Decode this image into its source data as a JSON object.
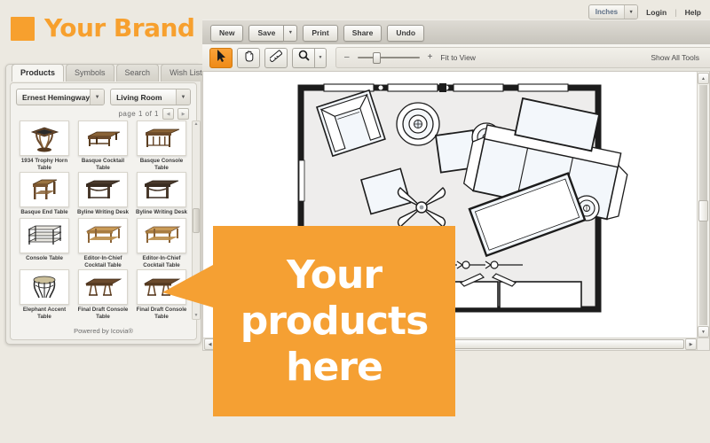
{
  "brand": {
    "name": "Your Brand",
    "mark_icon": "square-logo-mark",
    "accent_color": "#f7a02e"
  },
  "panel": {
    "tabs": [
      {
        "label": "Products",
        "active": true
      },
      {
        "label": "Symbols",
        "active": false
      },
      {
        "label": "Search",
        "active": false
      },
      {
        "label": "Wish List",
        "active": false
      }
    ],
    "selectors": [
      {
        "name": "brand-select",
        "value": "Ernest Hemingway"
      },
      {
        "name": "room-select",
        "value": "Living Room"
      }
    ],
    "pager": {
      "text": "page  1  of  1",
      "prev_icon": "chevron-left-icon",
      "next_icon": "chevron-right-icon"
    },
    "products": [
      {
        "label": "1934 Trophy Horn Table",
        "icon": "pedestal-table-thumb"
      },
      {
        "label": "Basque Cocktail Table",
        "icon": "cocktail-table-thumb"
      },
      {
        "label": "Basque Console Table",
        "icon": "console-table-thumb"
      },
      {
        "label": "Basque End Table",
        "icon": "end-table-thumb"
      },
      {
        "label": "Byline Writing Desk",
        "icon": "writing-desk-thumb"
      },
      {
        "label": "Byline Writing Desk",
        "icon": "writing-desk-thumb"
      },
      {
        "label": "Console Table",
        "icon": "metal-console-thumb"
      },
      {
        "label": "Editor-In-Chief Cocktail Table",
        "icon": "editor-cocktail-thumb"
      },
      {
        "label": "Editor-In-Chief Cocktail Table",
        "icon": "editor-cocktail-thumb"
      },
      {
        "label": "Elephant Accent Table",
        "icon": "accent-table-thumb"
      },
      {
        "label": "Final Draft Console Table",
        "icon": "final-draft-console-thumb"
      },
      {
        "label": "Final Draft Console Table",
        "icon": "final-draft-console-thumb"
      }
    ],
    "footer": "Powered by Icovia®"
  },
  "header": {
    "unit": {
      "value": "Inches",
      "caret_icon": "chevron-down-icon"
    },
    "login": "Login",
    "separator": "|",
    "help": "Help"
  },
  "toolbar": {
    "new_label": "New",
    "save_label": "Save",
    "save_caret_icon": "chevron-down-icon",
    "print_label": "Print",
    "share_label": "Share",
    "undo_label": "Undo"
  },
  "tools": {
    "select_icon": "cursor-arrow-icon",
    "pan_icon": "hand-icon",
    "measure_icon": "ruler-icon",
    "zoom_icon": "magnifier-icon",
    "zoom_caret_icon": "chevron-down-icon",
    "zoom_out_label": "–",
    "zoom_in_label": "+",
    "fit_to_view_label": "Fit to View",
    "show_all_tools_label": "Show All Tools"
  },
  "canvas": {
    "scroll": {
      "up_icon": "arrow-up-icon",
      "down_icon": "arrow-down-icon",
      "left_icon": "arrow-left-icon",
      "right_icon": "arrow-right-icon"
    },
    "floorplan_name": "living-room-floor-plan"
  },
  "callout": {
    "line1": "Your",
    "line2": "products",
    "line3": "here",
    "background_color": "#f5a033",
    "text_color": "#ffffff"
  }
}
